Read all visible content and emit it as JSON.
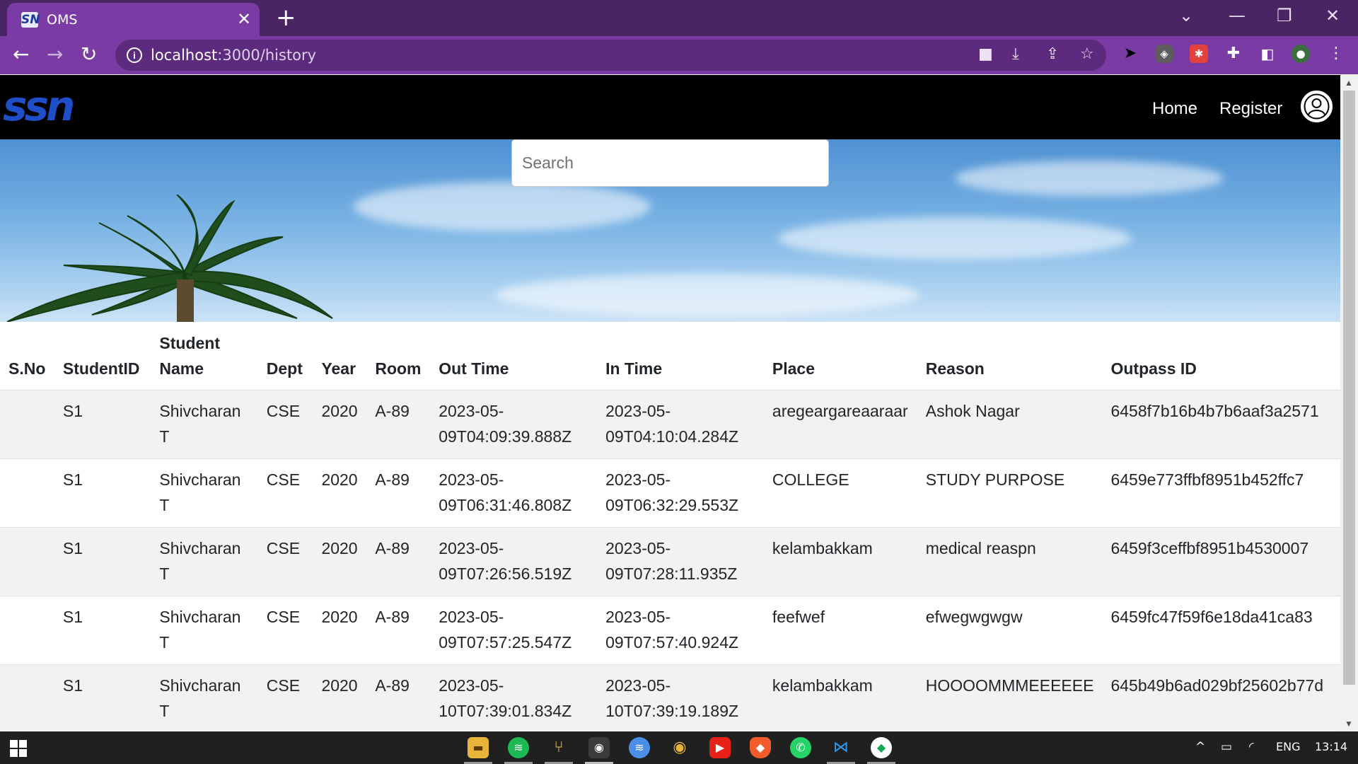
{
  "browser": {
    "tab_title": "OMS",
    "tab_favicon": "SN",
    "url_host": "localhost",
    "url_path": ":3000/history"
  },
  "navbar": {
    "logo_text": "ssn",
    "links": [
      "Home",
      "Register"
    ]
  },
  "search": {
    "placeholder": "Search",
    "value": ""
  },
  "table": {
    "headers": [
      "S.No",
      "StudentID",
      "Student Name",
      "Dept",
      "Year",
      "Room",
      "Out Time",
      "In Time",
      "Place",
      "Reason",
      "Outpass ID"
    ],
    "rows": [
      [
        "",
        "S1",
        "Shivcharan T",
        "CSE",
        "2020",
        "A-89",
        "2023-05-09T04:09:39.888Z",
        "2023-05-09T04:10:04.284Z",
        "aregeargareaaraar",
        "Ashok Nagar",
        "6458f7b16b4b7b6aaf3a2571"
      ],
      [
        "",
        "S1",
        "Shivcharan T",
        "CSE",
        "2020",
        "A-89",
        "2023-05-09T06:31:46.808Z",
        "2023-05-09T06:32:29.553Z",
        "COLLEGE",
        "STUDY PURPOSE",
        "6459e773ffbf8951b452ffc7"
      ],
      [
        "",
        "S1",
        "Shivcharan T",
        "CSE",
        "2020",
        "A-89",
        "2023-05-09T07:26:56.519Z",
        "2023-05-09T07:28:11.935Z",
        "kelambakkam",
        "medical reaspn",
        "6459f3ceffbf8951b4530007"
      ],
      [
        "",
        "S1",
        "Shivcharan T",
        "CSE",
        "2020",
        "A-89",
        "2023-05-09T07:57:25.547Z",
        "2023-05-09T07:57:40.924Z",
        "feefwef",
        "efwegwgwgw",
        "6459fc47f59f6e18da41ca83"
      ],
      [
        "",
        "S1",
        "Shivcharan T",
        "CSE",
        "2020",
        "A-89",
        "2023-05-10T07:39:01.834Z",
        "2023-05-10T07:39:19.189Z",
        "kelambakkam",
        "HOOOOMMMEEEEEE",
        "645b49b6ad029bf25602b77d"
      ]
    ]
  },
  "taskbar": {
    "apps": [
      "file-explorer-icon",
      "spotify-icon",
      "git-icon",
      "chrome-icon",
      "spotify-web-icon",
      "chrome-icon",
      "youtube-icon",
      "brave-icon",
      "whatsapp-icon",
      "vscode-icon",
      "mongodb-compass-icon"
    ],
    "language": "ENG",
    "time": "13:14"
  },
  "colors": {
    "tabstrip": "#4a2563",
    "toolbar": "#7a3ba4",
    "navbar": "#000000",
    "logo": "#1e4fc8",
    "row_stripe": "#f2f2f2"
  }
}
